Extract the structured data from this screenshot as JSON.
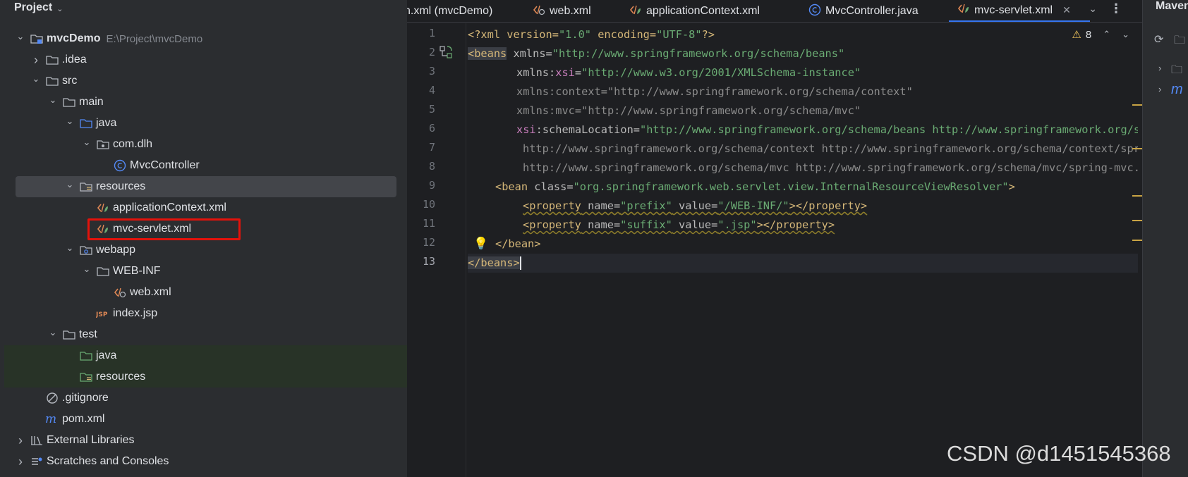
{
  "project_panel": {
    "title": "Project",
    "tree": [
      {
        "label": "mvcDemo",
        "hint": "E:\\Project\\mvcDemo",
        "icon": "module-folder-icon",
        "arrow": "expanded"
      },
      {
        "label": ".idea",
        "icon": "folder-icon",
        "arrow": "collapsed"
      },
      {
        "label": "src",
        "icon": "folder-icon",
        "arrow": "expanded"
      },
      {
        "label": "main",
        "icon": "folder-icon",
        "arrow": "expanded"
      },
      {
        "label": "java",
        "icon": "source-folder-icon",
        "arrow": "expanded"
      },
      {
        "label": "com.dlh",
        "icon": "package-icon",
        "arrow": "expanded"
      },
      {
        "label": "MvcController",
        "icon": "java-class-icon",
        "arrow": "none"
      },
      {
        "label": "resources",
        "icon": "resources-folder-icon",
        "arrow": "expanded"
      },
      {
        "label": "applicationContext.xml",
        "icon": "spring-xml-icon",
        "arrow": "none"
      },
      {
        "label": "mvc-servlet.xml",
        "icon": "spring-xml-icon",
        "arrow": "none"
      },
      {
        "label": "webapp",
        "icon": "web-folder-icon",
        "arrow": "expanded"
      },
      {
        "label": "WEB-INF",
        "icon": "folder-icon",
        "arrow": "expanded"
      },
      {
        "label": "web.xml",
        "icon": "web-xml-icon",
        "arrow": "none"
      },
      {
        "label": "index.jsp",
        "icon": "jsp-icon",
        "arrow": "none"
      },
      {
        "label": "test",
        "icon": "folder-icon",
        "arrow": "expanded"
      },
      {
        "label": "java",
        "icon": "test-folder-icon",
        "arrow": "none"
      },
      {
        "label": "resources",
        "icon": "test-resources-folder-icon",
        "arrow": "none"
      },
      {
        "label": ".gitignore",
        "icon": "gitignore-icon",
        "arrow": "none"
      },
      {
        "label": "pom.xml",
        "icon": "maven-icon",
        "arrow": "none"
      },
      {
        "label": "External Libraries",
        "icon": "libraries-icon",
        "arrow": "collapsed"
      },
      {
        "label": "Scratches and Consoles",
        "icon": "scratches-icon",
        "arrow": "collapsed"
      }
    ]
  },
  "editor": {
    "tabs": [
      {
        "label": "n.xml (mvcDemo)",
        "icon": "maven-icon"
      },
      {
        "label": "web.xml",
        "icon": "web-xml-icon"
      },
      {
        "label": "applicationContext.xml",
        "icon": "spring-xml-icon"
      },
      {
        "label": "MvcController.java",
        "icon": "java-class-icon"
      },
      {
        "label": "mvc-servlet.xml",
        "icon": "spring-xml-icon",
        "active": true
      }
    ],
    "inspection": {
      "warnings": "8"
    },
    "line_numbers": [
      "1",
      "2",
      "3",
      "4",
      "5",
      "6",
      "7",
      "8",
      "9",
      "10",
      "11",
      "12",
      "13"
    ],
    "code": {
      "l1": {
        "a": "<?xml version=",
        "b": "\"1.0\"",
        "c": " encoding=",
        "d": "\"UTF-8\"",
        "e": "?>"
      },
      "l2": {
        "a": "<beans",
        "b": " xmlns=",
        "c": "\"http://www.springframework.org/schema/beans\""
      },
      "l3": {
        "a": "xmlns:",
        "b": "xsi",
        "c": "=",
        "d": "\"http://www.w3.org/2001/XMLSchema-instance\""
      },
      "l4": {
        "a": "xmlns:context=",
        "b": "\"http://www.springframework.org/schema/context\""
      },
      "l5": {
        "a": "xmlns:mvc=",
        "b": "\"http://www.springframework.org/schema/mvc\""
      },
      "l6": {
        "a": "xsi",
        "b": ":schemaLocation=",
        "c": "\"http://www.springframework.org/schema/beans http://www.springframework.org/schema/beans/spring-beans.xsd"
      },
      "l7": {
        "a": "http://www.springframework.org/schema/context http://www.springframework.org/schema/context/spring-context.xsd"
      },
      "l8": {
        "a": "http://www.springframework.org/schema/mvc http://www.springframework.org/schema/mvc/spring-mvc.xsd\">"
      },
      "l9": {
        "a": "<bean",
        "b": " class=",
        "c": "\"org.springframework.web.servlet.view.InternalResourceViewResolver\"",
        "d": ">"
      },
      "l10": {
        "a": "<property",
        "b": " name=",
        "c": "\"prefix\"",
        "d": " value=",
        "e": "\"/WEB-INF/\"",
        "f": "></property>"
      },
      "l11": {
        "a": "<property",
        "b": " name=",
        "c": "\"suffix\"",
        "d": " value=",
        "e": "\".jsp\"",
        "f": "></property>"
      },
      "l12": {
        "a": "</bean>"
      },
      "l13": {
        "a": "</beans>"
      }
    }
  },
  "maven_panel": {
    "title": "Maven"
  },
  "watermark": "CSDN @d1451545368",
  "colors": {
    "accent": "#3574f0",
    "highlight_box": "#e3120b",
    "string": "#6aab73",
    "tag": "#d5b778"
  }
}
